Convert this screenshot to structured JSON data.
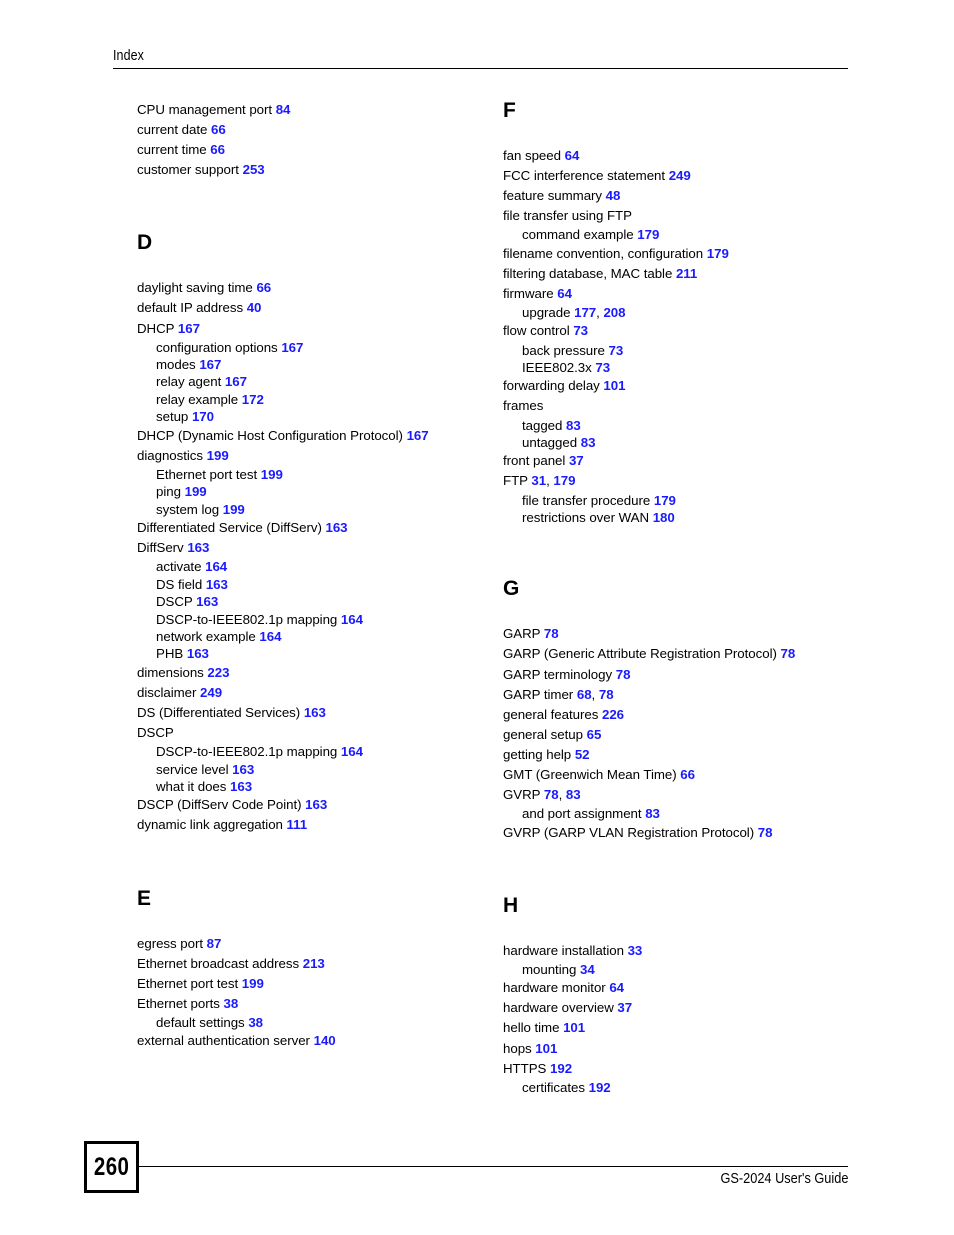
{
  "header": {
    "title": "Index"
  },
  "footer": {
    "page_number": "260",
    "guide_title": "GS-2024 User's Guide"
  },
  "columns": {
    "left": [
      {
        "letter": null,
        "entries": [
          {
            "level": 0,
            "text": "CPU management port",
            "pages": [
              "84"
            ]
          },
          {
            "level": 0,
            "text": "current date",
            "pages": [
              "66"
            ]
          },
          {
            "level": 0,
            "text": "current time",
            "pages": [
              "66"
            ]
          },
          {
            "level": 0,
            "text": "customer support",
            "pages": [
              "253"
            ]
          }
        ]
      },
      {
        "letter": "D",
        "entries": [
          {
            "level": 0,
            "text": "daylight saving time",
            "pages": [
              "66"
            ]
          },
          {
            "level": 0,
            "text": "default IP address",
            "pages": [
              "40"
            ]
          },
          {
            "level": 0,
            "text": "DHCP",
            "pages": [
              "167"
            ]
          },
          {
            "level": 1,
            "text": "configuration options",
            "pages": [
              "167"
            ]
          },
          {
            "level": 1,
            "text": "modes",
            "pages": [
              "167"
            ]
          },
          {
            "level": 1,
            "text": "relay agent",
            "pages": [
              "167"
            ]
          },
          {
            "level": 1,
            "text": "relay example",
            "pages": [
              "172"
            ]
          },
          {
            "level": 1,
            "text": "setup",
            "pages": [
              "170"
            ]
          },
          {
            "level": 0,
            "text": "DHCP (Dynamic Host Configuration Protocol)",
            "pages": [
              "167"
            ]
          },
          {
            "level": 0,
            "text": "diagnostics",
            "pages": [
              "199"
            ]
          },
          {
            "level": 1,
            "text": "Ethernet port test",
            "pages": [
              "199"
            ]
          },
          {
            "level": 1,
            "text": "ping",
            "pages": [
              "199"
            ]
          },
          {
            "level": 1,
            "text": "system log",
            "pages": [
              "199"
            ]
          },
          {
            "level": 0,
            "text": "Differentiated Service (DiffServ)",
            "pages": [
              "163"
            ]
          },
          {
            "level": 0,
            "text": "DiffServ",
            "pages": [
              "163"
            ]
          },
          {
            "level": 1,
            "text": "activate",
            "pages": [
              "164"
            ]
          },
          {
            "level": 1,
            "text": "DS field",
            "pages": [
              "163"
            ]
          },
          {
            "level": 1,
            "text": "DSCP",
            "pages": [
              "163"
            ]
          },
          {
            "level": 1,
            "text": "DSCP-to-IEEE802.1p mapping",
            "pages": [
              "164"
            ]
          },
          {
            "level": 1,
            "text": "network example",
            "pages": [
              "164"
            ]
          },
          {
            "level": 1,
            "text": "PHB",
            "pages": [
              "163"
            ]
          },
          {
            "level": 0,
            "text": "dimensions",
            "pages": [
              "223"
            ]
          },
          {
            "level": 0,
            "text": "disclaimer",
            "pages": [
              "249"
            ]
          },
          {
            "level": 0,
            "text": "DS (Differentiated Services)",
            "pages": [
              "163"
            ]
          },
          {
            "level": 0,
            "text": "DSCP",
            "pages": []
          },
          {
            "level": 1,
            "text": "DSCP-to-IEEE802.1p mapping",
            "pages": [
              "164"
            ]
          },
          {
            "level": 1,
            "text": "service level",
            "pages": [
              "163"
            ]
          },
          {
            "level": 1,
            "text": "what it does",
            "pages": [
              "163"
            ]
          },
          {
            "level": 0,
            "text": "DSCP (DiffServ Code Point)",
            "pages": [
              "163"
            ]
          },
          {
            "level": 0,
            "text": "dynamic link aggregation",
            "pages": [
              "111"
            ]
          }
        ]
      },
      {
        "letter": "E",
        "entries": [
          {
            "level": 0,
            "text": "egress port",
            "pages": [
              "87"
            ]
          },
          {
            "level": 0,
            "text": "Ethernet broadcast address",
            "pages": [
              "213"
            ]
          },
          {
            "level": 0,
            "text": "Ethernet port test",
            "pages": [
              "199"
            ]
          },
          {
            "level": 0,
            "text": "Ethernet ports",
            "pages": [
              "38"
            ]
          },
          {
            "level": 1,
            "text": "default settings",
            "pages": [
              "38"
            ]
          },
          {
            "level": 0,
            "text": "external authentication server",
            "pages": [
              "140"
            ]
          }
        ]
      }
    ],
    "right": [
      {
        "letter": "F",
        "entries": [
          {
            "level": 0,
            "text": "fan speed",
            "pages": [
              "64"
            ]
          },
          {
            "level": 0,
            "text": "FCC interference statement",
            "pages": [
              "249"
            ]
          },
          {
            "level": 0,
            "text": "feature summary",
            "pages": [
              "48"
            ]
          },
          {
            "level": 0,
            "text": "file transfer using FTP",
            "pages": []
          },
          {
            "level": 1,
            "text": "command example",
            "pages": [
              "179"
            ]
          },
          {
            "level": 0,
            "text": "filename convention, configuration",
            "pages": [
              "179"
            ]
          },
          {
            "level": 0,
            "text": "filtering database, MAC table",
            "pages": [
              "211"
            ]
          },
          {
            "level": 0,
            "text": "firmware",
            "pages": [
              "64"
            ]
          },
          {
            "level": 1,
            "text": "upgrade",
            "pages": [
              "177",
              "208"
            ]
          },
          {
            "level": 0,
            "text": "flow control",
            "pages": [
              "73"
            ]
          },
          {
            "level": 1,
            "text": "back pressure",
            "pages": [
              "73"
            ]
          },
          {
            "level": 1,
            "text": "IEEE802.3x",
            "pages": [
              "73"
            ]
          },
          {
            "level": 0,
            "text": "forwarding delay",
            "pages": [
              "101"
            ]
          },
          {
            "level": 0,
            "text": "frames",
            "pages": []
          },
          {
            "level": 1,
            "text": "tagged",
            "pages": [
              "83"
            ]
          },
          {
            "level": 1,
            "text": "untagged",
            "pages": [
              "83"
            ]
          },
          {
            "level": 0,
            "text": "front panel",
            "pages": [
              "37"
            ]
          },
          {
            "level": 0,
            "text": "FTP",
            "pages": [
              "31",
              "179"
            ]
          },
          {
            "level": 1,
            "text": "file transfer procedure",
            "pages": [
              "179"
            ]
          },
          {
            "level": 1,
            "text": "restrictions over WAN",
            "pages": [
              "180"
            ]
          }
        ]
      },
      {
        "letter": "G",
        "entries": [
          {
            "level": 0,
            "text": "GARP",
            "pages": [
              "78"
            ]
          },
          {
            "level": 0,
            "text": "GARP (Generic Attribute Registration Protocol)",
            "pages": [
              "78"
            ]
          },
          {
            "level": 0,
            "text": "GARP terminology",
            "pages": [
              "78"
            ]
          },
          {
            "level": 0,
            "text": "GARP timer",
            "pages": [
              "68",
              "78"
            ]
          },
          {
            "level": 0,
            "text": "general features",
            "pages": [
              "226"
            ]
          },
          {
            "level": 0,
            "text": "general setup",
            "pages": [
              "65"
            ]
          },
          {
            "level": 0,
            "text": "getting help",
            "pages": [
              "52"
            ]
          },
          {
            "level": 0,
            "text": "GMT (Greenwich Mean Time)",
            "pages": [
              "66"
            ]
          },
          {
            "level": 0,
            "text": "GVRP",
            "pages": [
              "78",
              "83"
            ]
          },
          {
            "level": 1,
            "text": "and port assignment",
            "pages": [
              "83"
            ]
          },
          {
            "level": 0,
            "text": "GVRP (GARP VLAN Registration Protocol)",
            "pages": [
              "78"
            ]
          }
        ]
      },
      {
        "letter": "H",
        "entries": [
          {
            "level": 0,
            "text": "hardware installation",
            "pages": [
              "33"
            ]
          },
          {
            "level": 1,
            "text": "mounting",
            "pages": [
              "34"
            ]
          },
          {
            "level": 0,
            "text": "hardware monitor",
            "pages": [
              "64"
            ]
          },
          {
            "level": 0,
            "text": "hardware overview",
            "pages": [
              "37"
            ]
          },
          {
            "level": 0,
            "text": "hello time",
            "pages": [
              "101"
            ]
          },
          {
            "level": 0,
            "text": "hops",
            "pages": [
              "101"
            ]
          },
          {
            "level": 0,
            "text": "HTTPS",
            "pages": [
              "192"
            ]
          },
          {
            "level": 1,
            "text": "certificates",
            "pages": [
              "192"
            ]
          }
        ]
      }
    ]
  },
  "colors": {
    "page_link": "#1a1aff",
    "text": "#000000"
  }
}
